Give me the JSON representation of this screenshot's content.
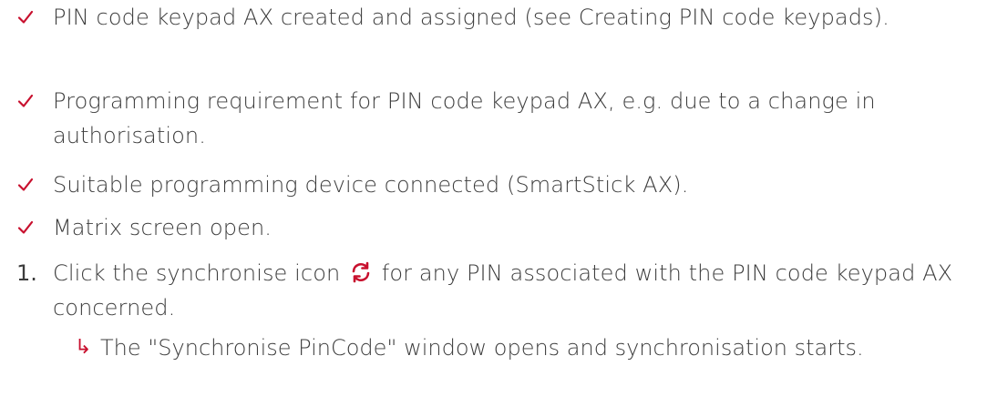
{
  "requirements": [
    {
      "text": "PIN code keypad AX created and assigned (see Creating PIN code keypads)."
    },
    {
      "text": "Programming requirement for PIN code keypad AX, e.g. due to a change in authorisation."
    },
    {
      "text": "Suitable programming device connected (SmartStick AX)."
    },
    {
      "text": "Matrix screen open."
    }
  ],
  "steps": [
    {
      "number": "1.",
      "text_before_icon": "Click the synchronise icon",
      "icon": "sync-icon",
      "text_after_icon": "for any PIN associated with the PIN code keypad AX concerned.",
      "result": {
        "arrow": "↳",
        "text": "The \"Synchronise PinCode\" window opens and synchronisation starts."
      }
    }
  ],
  "colors": {
    "accent": "#c8102e",
    "text": "#3c3c3c"
  }
}
